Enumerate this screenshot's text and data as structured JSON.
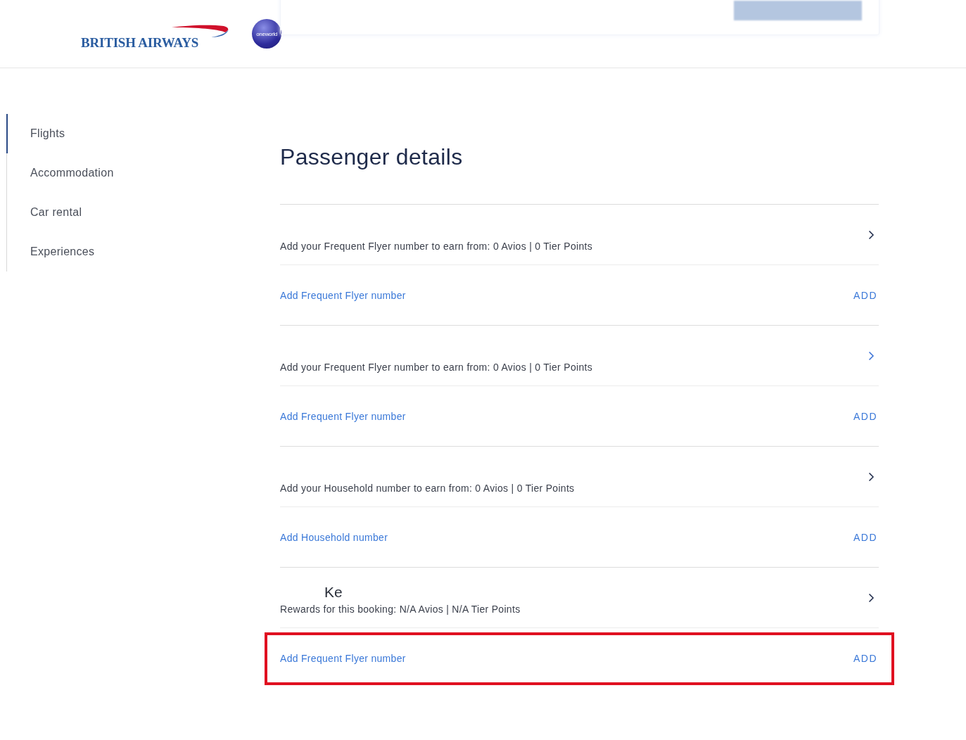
{
  "header": {
    "brand": "BRITISH AIRWAYS",
    "alliance": "oneworld"
  },
  "sidebar": {
    "items": [
      {
        "label": "Flights",
        "selected": true
      },
      {
        "label": "Accommodation",
        "selected": false
      },
      {
        "label": "Car rental",
        "selected": false
      },
      {
        "label": "Experiences",
        "selected": false
      }
    ]
  },
  "title": "Passenger details",
  "passengers": [
    {
      "rewards": "Add your Frequent Flyer number to earn from: 0 Avios | 0 Tier Points",
      "chevron_hovered": false,
      "link": "Add Frequent Flyer number",
      "action": "ADD",
      "highlighted": false
    },
    {
      "rewards": "Add your Frequent Flyer number to earn from: 0 Avios | 0 Tier Points",
      "chevron_hovered": true,
      "link": "Add Frequent Flyer number",
      "action": "ADD",
      "highlighted": false
    },
    {
      "rewards": "Add your Household number to earn from: 0 Avios | 0 Tier Points",
      "chevron_hovered": false,
      "link": "Add Household number",
      "action": "ADD",
      "highlighted": false
    },
    {
      "name": "Ke",
      "rewards": "Rewards for this booking: N/A Avios | N/A Tier Points",
      "chevron_hovered": false,
      "link": "Add Frequent Flyer number",
      "action": "ADD",
      "highlighted": true
    }
  ]
}
